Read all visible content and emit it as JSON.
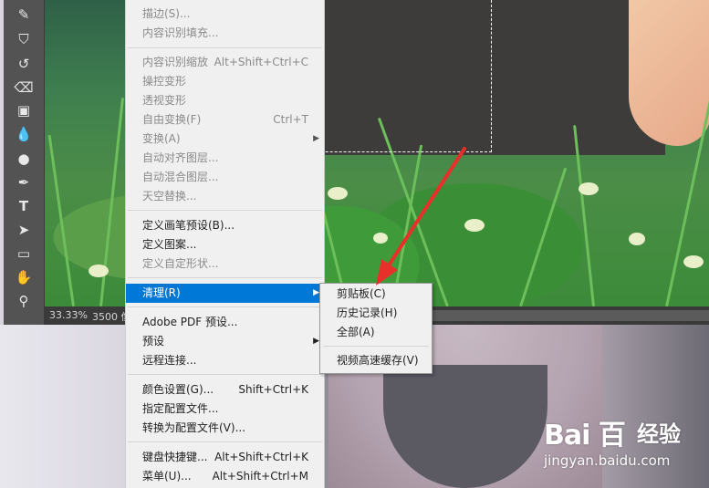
{
  "statusbar": {
    "zoom": "33.33%",
    "doc_info": "3500 像"
  },
  "edit_menu": {
    "items": [
      {
        "label": "描边(S)...",
        "shortcut": "",
        "disabled": true
      },
      {
        "label": "内容识别填充...",
        "shortcut": "",
        "disabled": true
      },
      {
        "label": "内容识别缩放",
        "shortcut": "Alt+Shift+Ctrl+C",
        "disabled": true
      },
      {
        "label": "操控变形",
        "shortcut": "",
        "disabled": true
      },
      {
        "label": "透视变形",
        "shortcut": "",
        "disabled": true
      },
      {
        "label": "自由变换(F)",
        "shortcut": "Ctrl+T",
        "disabled": true
      },
      {
        "label": "变换(A)",
        "shortcut": "",
        "disabled": true
      },
      {
        "label": "自动对齐图层...",
        "shortcut": "",
        "disabled": true
      },
      {
        "label": "自动混合图层...",
        "shortcut": "",
        "disabled": true
      },
      {
        "label": "天空替换...",
        "shortcut": "",
        "disabled": true
      },
      {
        "label": "定义画笔预设(B)...",
        "shortcut": "",
        "disabled": false
      },
      {
        "label": "定义图案...",
        "shortcut": "",
        "disabled": false
      },
      {
        "label": "定义自定形状...",
        "shortcut": "",
        "disabled": true
      },
      {
        "label": "清理(R)",
        "shortcut": "",
        "disabled": false,
        "highlighted": true
      },
      {
        "label": "Adobe PDF 预设...",
        "shortcut": "",
        "disabled": false
      },
      {
        "label": "预设",
        "shortcut": "",
        "disabled": false
      },
      {
        "label": "远程连接...",
        "shortcut": "",
        "disabled": false
      },
      {
        "label": "颜色设置(G)...",
        "shortcut": "Shift+Ctrl+K",
        "disabled": false
      },
      {
        "label": "指定配置文件...",
        "shortcut": "",
        "disabled": false
      },
      {
        "label": "转换为配置文件(V)...",
        "shortcut": "",
        "disabled": false
      },
      {
        "label": "键盘快捷键...",
        "shortcut": "Alt+Shift+Ctrl+K",
        "disabled": false
      },
      {
        "label": "菜单(U)...",
        "shortcut": "Alt+Shift+Ctrl+M",
        "disabled": false
      }
    ]
  },
  "purge_submenu": {
    "items": [
      {
        "label": "剪贴板(C)"
      },
      {
        "label": "历史记录(H)"
      },
      {
        "label": "全部(A)"
      },
      {
        "label": "视频高速缓存(V)"
      }
    ]
  },
  "watermark": {
    "brand": "Bai 百",
    "cn": "经验",
    "url": "jingyan.baidu.com"
  },
  "colors": {
    "highlight": "#0078d7",
    "arrow": "#e8302a",
    "menu_bg": "#f0f0f0"
  }
}
